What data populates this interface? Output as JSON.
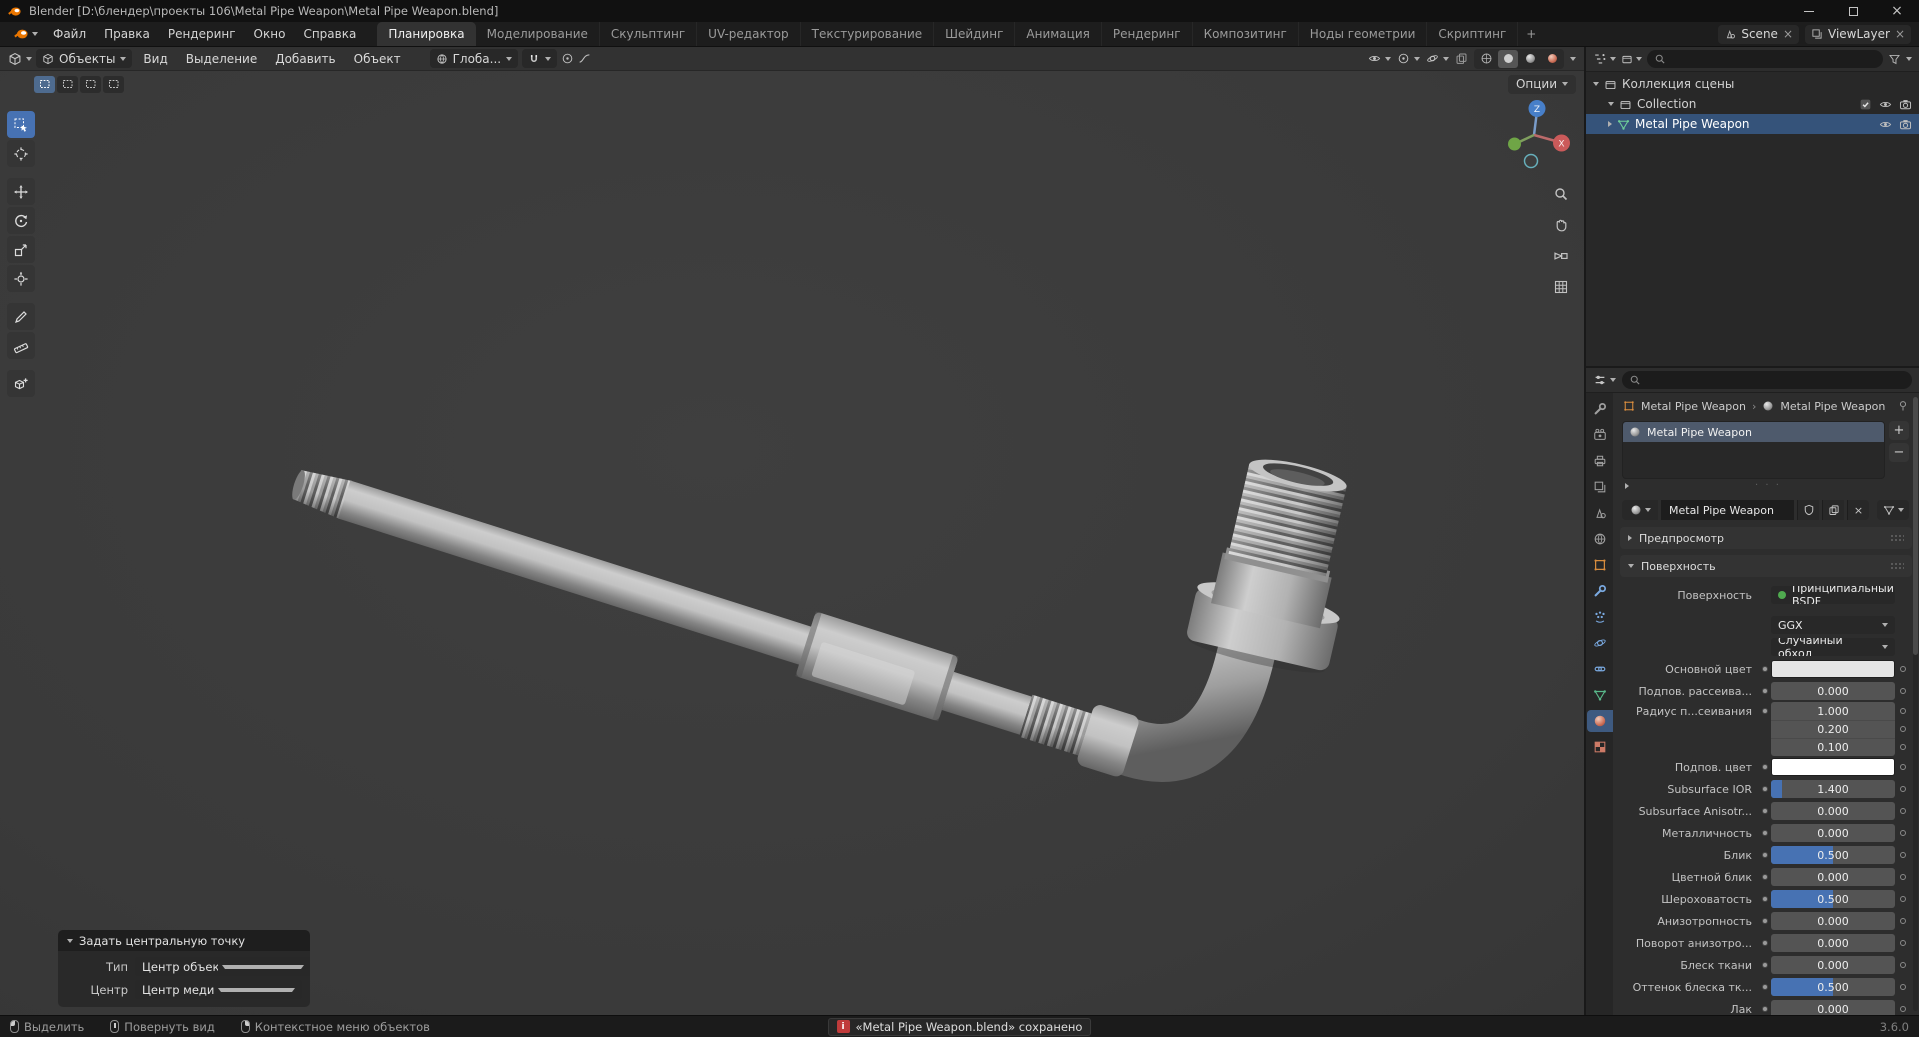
{
  "titlebar": {
    "title": "Blender [D:\\блендер\\проекты 106\\Metal Pipe Weapon\\Metal Pipe Weapon.blend]"
  },
  "topbar": {
    "menus": [
      "Файл",
      "Правка",
      "Рендеринг",
      "Окно",
      "Справка"
    ],
    "workspaces": [
      "Планировка",
      "Моделирование",
      "Скульптинг",
      "UV-редактор",
      "Текстурирование",
      "Шейдинг",
      "Анимация",
      "Рендеринг",
      "Композитинг",
      "Ноды геометрии",
      "Скриптинг"
    ],
    "add_tab": "+",
    "scene": "Scene",
    "view_layer": "ViewLayer"
  },
  "viewport": {
    "mode": "Объекты",
    "menus": [
      "Вид",
      "Выделение",
      "Добавить",
      "Объект"
    ],
    "orientation": "Глоба...",
    "options": "Опции",
    "gizmo_axes": {
      "x": "X",
      "z": "Z"
    }
  },
  "outliner": {
    "scene_collection": "Коллекция сцены",
    "collection": "Collection",
    "object": "Metal Pipe Weapon"
  },
  "properties": {
    "breadcrumb_object": "Metal Pipe Weapon",
    "breadcrumb_material": "Metal Pipe Weapon",
    "slot_name": "Metal Pipe Weapon",
    "material_name": "Metal Pipe Weapon",
    "preview_panel": "Предпросмотр",
    "surface_panel": "Поверхность",
    "rows": [
      {
        "label": "Поверхность",
        "value": "Принципиальный BSDF"
      },
      {
        "label": "",
        "value": "GGX"
      },
      {
        "label": "",
        "value": "Случайный обход"
      },
      {
        "label": "Основной цвет",
        "value": "",
        "swatch": "#e4e4e4"
      },
      {
        "label": "Подпов. рассеива...",
        "value": "0.000",
        "fill": 0
      },
      {
        "label": "Радиус п...сеивания",
        "value": "1.000",
        "fill": 0
      },
      {
        "label": "",
        "value": "0.200",
        "fill": 0
      },
      {
        "label": "",
        "value": "0.100",
        "fill": 0
      },
      {
        "label": "Подпов. цвет",
        "value": "",
        "swatch": "#ffffff"
      },
      {
        "label": "Subsurface IOR",
        "value": "1.400",
        "fill": 9
      },
      {
        "label": "Subsurface Anisotr...",
        "value": "0.000",
        "fill": 0
      },
      {
        "label": "Металличность",
        "value": "0.000",
        "fill": 0
      },
      {
        "label": "Блик",
        "value": "0.500",
        "fill": 50
      },
      {
        "label": "Цветной блик",
        "value": "0.000",
        "fill": 0
      },
      {
        "label": "Шероховатость",
        "value": "0.500",
        "fill": 50
      },
      {
        "label": "Анизотропность",
        "value": "0.000",
        "fill": 0
      },
      {
        "label": "Поворот анизотро...",
        "value": "0.000",
        "fill": 0
      },
      {
        "label": "Блеск ткани",
        "value": "0.000",
        "fill": 0
      },
      {
        "label": "Оттенок блеска тк...",
        "value": "0.500",
        "fill": 50
      },
      {
        "label": "Лак",
        "value": "0.000",
        "fill": 0
      }
    ]
  },
  "operator_panel": {
    "title": "Задать центральную точку",
    "fields": [
      {
        "label": "Тип",
        "value": "Центр объекта к геоме..."
      },
      {
        "label": "Центр",
        "value": "Центр медианы"
      }
    ]
  },
  "statusbar": {
    "hints": [
      "Выделить",
      "Повернуть вид",
      "Контекстное меню объектов"
    ],
    "notification": "«Metal Pipe Weapon.blend» сохранено",
    "version": "3.6.0"
  },
  "colors": {
    "accent": "#4772b3",
    "selection": "#35537a",
    "axis_x": "#cb5a5a",
    "axis_y": "#6fa546",
    "axis_z": "#477fc9"
  },
  "icons": [
    "blender-logo",
    "search-icon",
    "filter-funnel-icon",
    "eye-icon",
    "camera-icon",
    "checkbox-icon",
    "mesh-data-icon",
    "object-icon",
    "material-sphere-icon",
    "magnet-icon",
    "globe-icon",
    "mouse-left-icon",
    "mouse-middle-icon",
    "mouse-right-icon"
  ]
}
